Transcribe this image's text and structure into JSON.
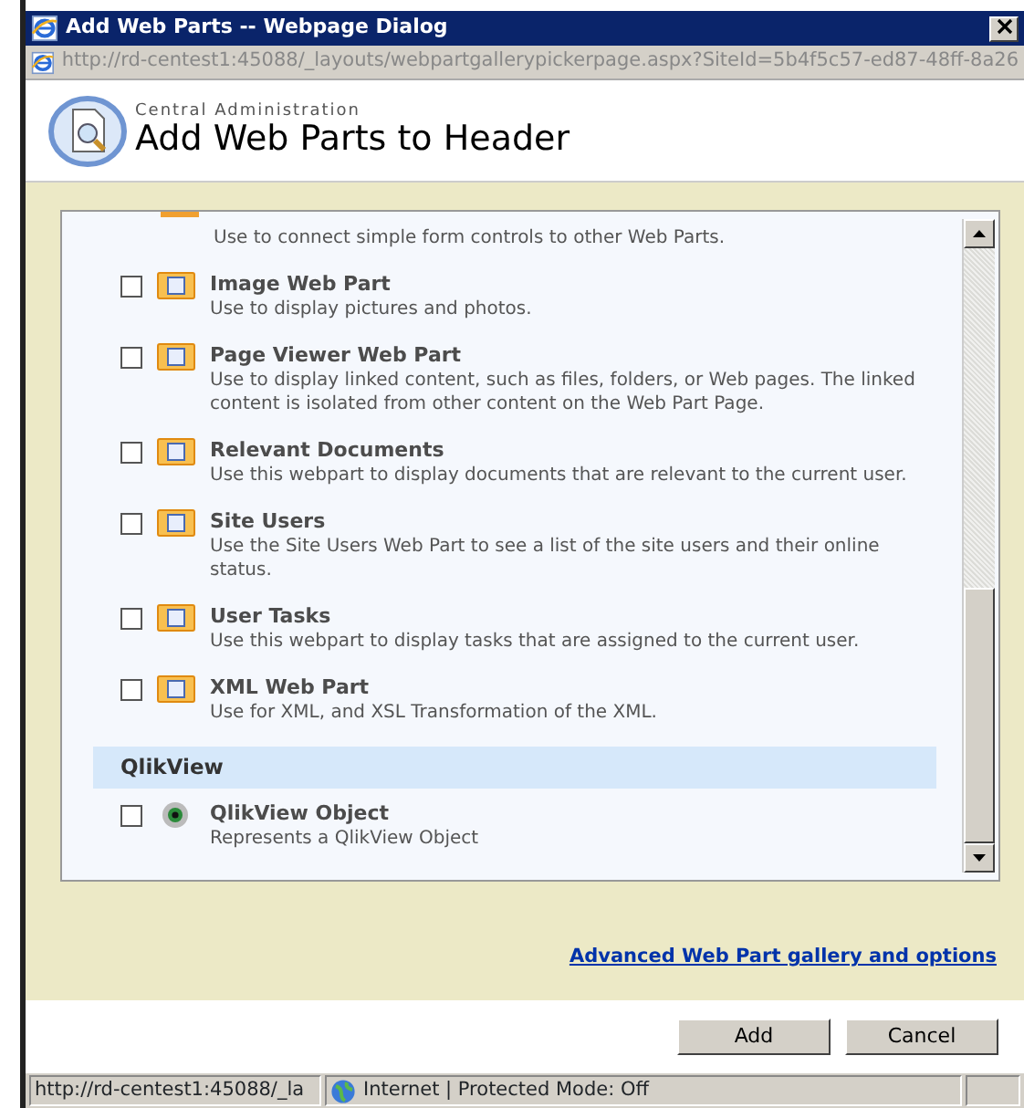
{
  "window": {
    "title": "Add Web Parts -- Webpage Dialog",
    "address": "http://rd-centest1:45088/_layouts/webpartgallerypickerpage.aspx?SiteId=5b4f5c57-ed87-48ff-8a26"
  },
  "header": {
    "site": "Central Administration",
    "title": "Add Web Parts to Header"
  },
  "groups": [
    {
      "items": [
        {
          "kind": "partial",
          "description": "Use to connect simple form controls to other Web Parts."
        },
        {
          "kind": "webpart",
          "title": "Image Web Part",
          "description": "Use to display pictures and photos.",
          "checked": false
        },
        {
          "kind": "webpart",
          "title": "Page Viewer Web Part",
          "description": "Use to display linked content, such as files, folders, or Web pages. The linked content is isolated from other content on the Web Part Page.",
          "checked": false
        },
        {
          "kind": "webpart",
          "title": "Relevant Documents",
          "description": "Use this webpart to display documents that are relevant to the current user.",
          "checked": false
        },
        {
          "kind": "webpart",
          "title": "Site Users",
          "description": "Use the Site Users Web Part to see a list of the site users and their online status.",
          "checked": false
        },
        {
          "kind": "webpart",
          "title": "User Tasks",
          "description": "Use this webpart to display tasks that are assigned to the current user.",
          "checked": false
        },
        {
          "kind": "webpart",
          "title": "XML Web Part",
          "description": "Use for XML, and XSL Transformation of the XML.",
          "checked": false
        }
      ]
    },
    {
      "name": "QlikView",
      "items": [
        {
          "kind": "qlik",
          "title": "QlikView Object",
          "description": "Represents a QlikView Object",
          "checked": false
        }
      ]
    }
  ],
  "advanced_link": "Advanced Web Part gallery and options",
  "buttons": [
    "Add",
    "Cancel"
  ],
  "status_bar": {
    "url": "http://rd-centest1:45088/_la",
    "zone": "Internet | Protected Mode: Off"
  }
}
